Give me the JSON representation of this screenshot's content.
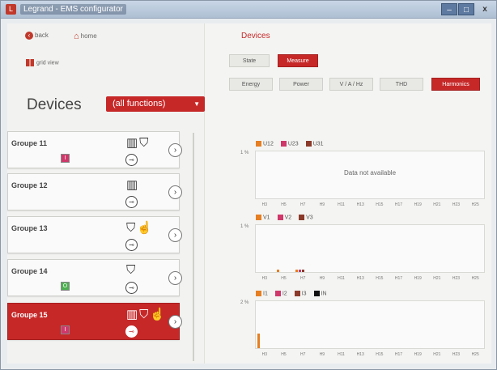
{
  "window": {
    "title": "Legrand - EMS configurator",
    "minimize": "–",
    "maximize": "□",
    "close": "x"
  },
  "nav": {
    "back": "back",
    "home": "home",
    "grid_view": "grid view"
  },
  "left": {
    "title": "Devices",
    "filter": "(all functions)"
  },
  "groups": [
    {
      "name": "Groupe 11",
      "led": "I",
      "led_color": "#d0376a",
      "icons": "▥⛉"
    },
    {
      "name": "Groupe 12",
      "led": "",
      "led_color": "",
      "icons": "▥"
    },
    {
      "name": "Groupe 13",
      "led": "",
      "led_color": "",
      "icons": "⛉☝"
    },
    {
      "name": "Groupe 14",
      "led": "O",
      "led_color": "#4caf50",
      "icons": "⛉"
    },
    {
      "name": "Groupe 15",
      "led": "I",
      "led_color": "#d0376a",
      "icons": "▥⛉☝"
    }
  ],
  "right": {
    "title": "Devices",
    "tabs": [
      "State",
      "Measure"
    ],
    "subtabs": [
      "Energy",
      "Power",
      "V / A / Hz",
      "THD",
      "Harmonics"
    ]
  },
  "colors": {
    "accent": "#c62828",
    "orange": "#e67e22",
    "red": "#d0376a",
    "brown": "#8b3a2a",
    "black": "#111111"
  },
  "charts": [
    {
      "ylabel": "1 %",
      "legend": [
        {
          "name": "U12",
          "color": "#e67e22"
        },
        {
          "name": "U23",
          "color": "#d0376a"
        },
        {
          "name": "U31",
          "color": "#8b3a2a"
        }
      ],
      "message": "Data not available",
      "x": [
        "H3",
        "H5",
        "H7",
        "H9",
        "H11",
        "H13",
        "H15",
        "H17",
        "H19",
        "H21",
        "H23",
        "H25"
      ],
      "values": []
    },
    {
      "ylabel": "1 %",
      "legend": [
        {
          "name": "V1",
          "color": "#e67e22"
        },
        {
          "name": "V2",
          "color": "#d0376a"
        },
        {
          "name": "V3",
          "color": "#8b3a2a"
        }
      ],
      "message": "",
      "x": [
        "H3",
        "H5",
        "H7",
        "H9",
        "H11",
        "H13",
        "H15",
        "H17",
        "H19",
        "H21",
        "H23",
        "H25"
      ],
      "series": [
        {
          "values": [
            0,
            0.05,
            0.05,
            0,
            0,
            0,
            0,
            0,
            0,
            0,
            0,
            0
          ]
        },
        {
          "values": [
            0,
            0,
            0.05,
            0,
            0,
            0,
            0,
            0,
            0,
            0,
            0,
            0
          ]
        },
        {
          "values": [
            0,
            0,
            0.05,
            0,
            0,
            0,
            0,
            0,
            0,
            0,
            0,
            0
          ]
        }
      ]
    },
    {
      "ylabel": "2 %",
      "legend": [
        {
          "name": "I1",
          "color": "#e67e22"
        },
        {
          "name": "I2",
          "color": "#d0376a"
        },
        {
          "name": "I3",
          "color": "#8b3a2a"
        },
        {
          "name": "IN",
          "color": "#111111"
        }
      ],
      "message": "",
      "x": [
        "H3",
        "H5",
        "H7",
        "H9",
        "H11",
        "H13",
        "H15",
        "H17",
        "H19",
        "H21",
        "H23",
        "H25"
      ],
      "series": [
        {
          "values": [
            0.6,
            0,
            0,
            0,
            0,
            0,
            0,
            0,
            0,
            0,
            0,
            0
          ]
        },
        {
          "values": [
            0,
            0,
            0,
            0,
            0,
            0,
            0,
            0,
            0,
            0,
            0,
            0
          ]
        },
        {
          "values": [
            0,
            0,
            0,
            0,
            0,
            0,
            0,
            0,
            0,
            0,
            0,
            0
          ]
        },
        {
          "values": [
            0,
            0,
            0,
            0,
            0,
            0,
            0,
            0,
            0,
            0,
            0,
            0
          ]
        }
      ]
    }
  ]
}
